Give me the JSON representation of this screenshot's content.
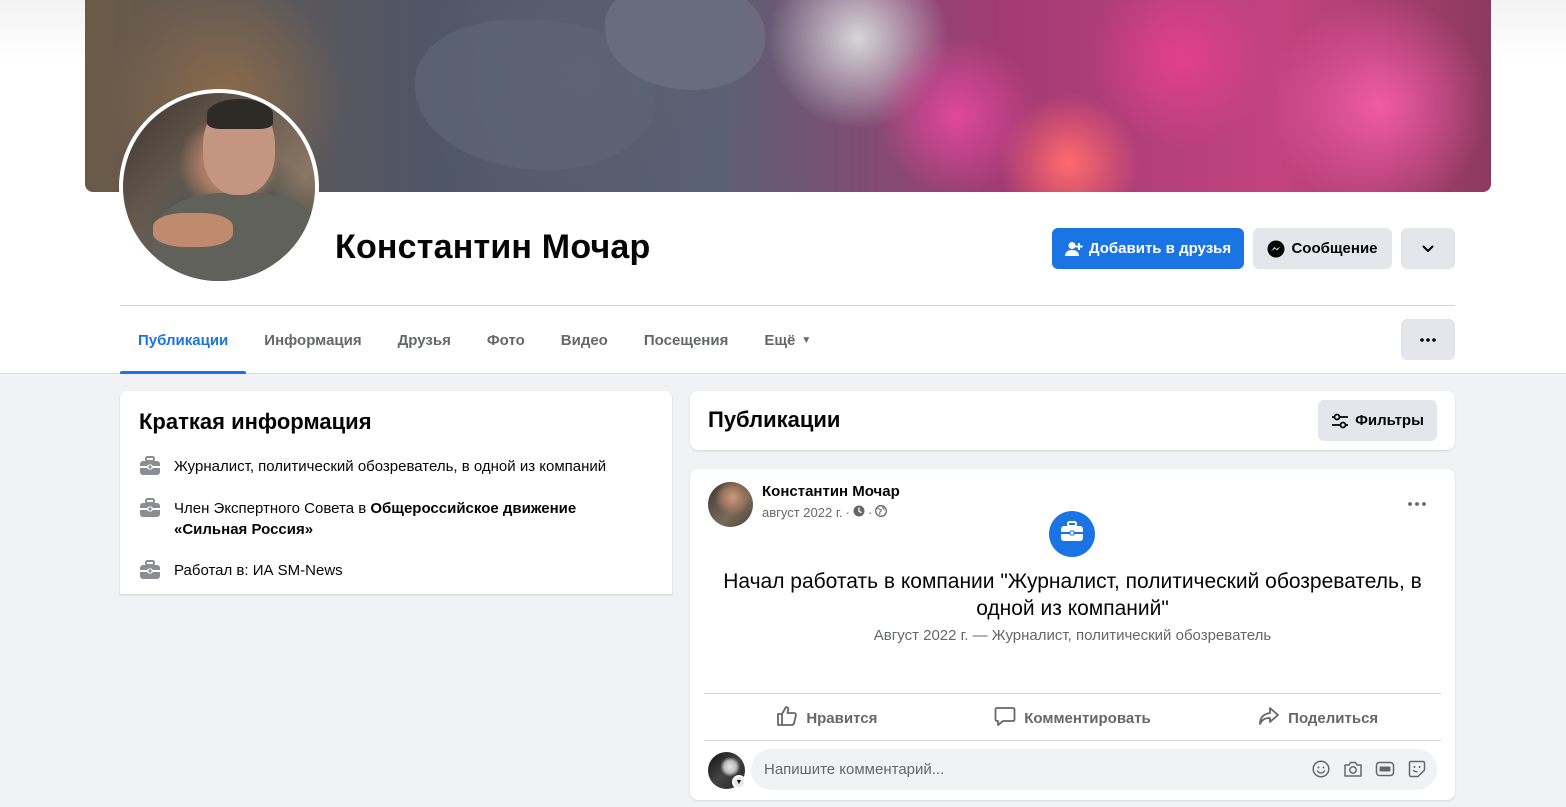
{
  "profile": {
    "name": "Константин Мочар"
  },
  "actions": {
    "add_friend": "Добавить в друзья",
    "message": "Сообщение"
  },
  "tabs": [
    {
      "label": "Публикации",
      "active": true
    },
    {
      "label": "Информация"
    },
    {
      "label": "Друзья"
    },
    {
      "label": "Фото"
    },
    {
      "label": "Видео"
    },
    {
      "label": "Посещения"
    },
    {
      "label": "Ещё"
    }
  ],
  "intro": {
    "title": "Краткая информация",
    "items": [
      {
        "icon": "briefcase-icon",
        "text": "Журналист, политический обозреватель, в одной из компаний"
      },
      {
        "icon": "briefcase-icon",
        "prefix": "Член Экспертного Совета в ",
        "bold": "Общероссийское движение «Сильная Россия»"
      },
      {
        "icon": "briefcase-icon",
        "text": "Работал в: ИА SM-News"
      }
    ]
  },
  "posts": {
    "title": "Публикации",
    "filter_label": "Фильтры"
  },
  "post": {
    "author": "Константин Мочар",
    "date": "август 2022 г.",
    "separator": "·",
    "life_event_title": "Начал работать в компании \"Журналист, политический обозреватель, в одной из компаний\"",
    "life_event_subtitle": "Август 2022 г. — Журналист, политический обозреватель",
    "like": "Нравится",
    "comment": "Комментировать",
    "share": "Поделиться",
    "comment_placeholder": "Напишите комментарий..."
  },
  "colors": {
    "accent": "#1b74e4",
    "page_bg": "#f0f2f5",
    "secondary_button": "#e4e6eb",
    "muted_text": "#65676b"
  }
}
